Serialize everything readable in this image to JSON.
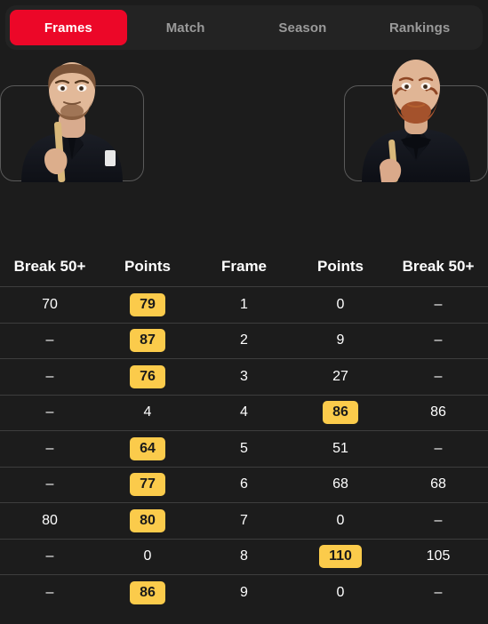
{
  "tabs": [
    {
      "label": "Frames",
      "active": true
    },
    {
      "label": "Match",
      "active": false
    },
    {
      "label": "Season",
      "active": false
    },
    {
      "label": "Rankings",
      "active": false
    }
  ],
  "colors": {
    "background": "#1c1c1c",
    "tabbar_background": "#232323",
    "active_tab": "#ec0728",
    "badge": "#fbcb4b",
    "divider": "#3e3e3e",
    "inactive_text": "#9a9a9a"
  },
  "players": {
    "left": {
      "icon": "player-photo-left",
      "description": "snooker player holding cue"
    },
    "right": {
      "icon": "player-photo-right",
      "description": "bald bearded snooker player holding cue"
    }
  },
  "table": {
    "headers": [
      "Break 50+",
      "Points",
      "Frame",
      "Points",
      "Break 50+"
    ],
    "rows": [
      {
        "left_break": "70",
        "left_points": "79",
        "left_highlight": true,
        "frame": "1",
        "right_points": "0",
        "right_highlight": false,
        "right_break": "–"
      },
      {
        "left_break": "–",
        "left_points": "87",
        "left_highlight": true,
        "frame": "2",
        "right_points": "9",
        "right_highlight": false,
        "right_break": "–"
      },
      {
        "left_break": "–",
        "left_points": "76",
        "left_highlight": true,
        "frame": "3",
        "right_points": "27",
        "right_highlight": false,
        "right_break": "–"
      },
      {
        "left_break": "–",
        "left_points": "4",
        "left_highlight": false,
        "frame": "4",
        "right_points": "86",
        "right_highlight": true,
        "right_break": "86"
      },
      {
        "left_break": "–",
        "left_points": "64",
        "left_highlight": true,
        "frame": "5",
        "right_points": "51",
        "right_highlight": false,
        "right_break": "–"
      },
      {
        "left_break": "–",
        "left_points": "77",
        "left_highlight": true,
        "frame": "6",
        "right_points": "68",
        "right_highlight": false,
        "right_break": "68"
      },
      {
        "left_break": "80",
        "left_points": "80",
        "left_highlight": true,
        "frame": "7",
        "right_points": "0",
        "right_highlight": false,
        "right_break": "–"
      },
      {
        "left_break": "–",
        "left_points": "0",
        "left_highlight": false,
        "frame": "8",
        "right_points": "110",
        "right_highlight": true,
        "right_break": "105"
      },
      {
        "left_break": "–",
        "left_points": "86",
        "left_highlight": true,
        "frame": "9",
        "right_points": "0",
        "right_highlight": false,
        "right_break": "–"
      }
    ]
  }
}
